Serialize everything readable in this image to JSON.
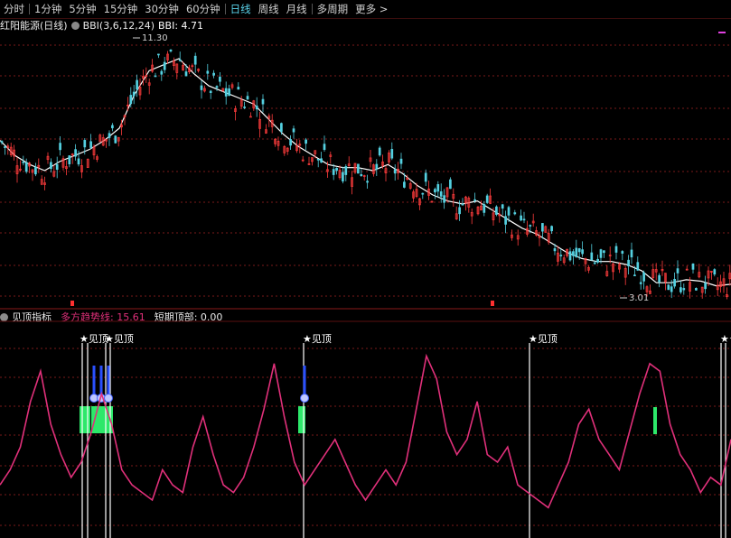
{
  "toolbar": {
    "items": [
      {
        "label": "分时",
        "active": false
      },
      {
        "label": "1分钟",
        "active": false
      },
      {
        "label": "5分钟",
        "active": false
      },
      {
        "label": "15分钟",
        "active": false
      },
      {
        "label": "30分钟",
        "active": false
      },
      {
        "label": "60分钟",
        "active": false
      },
      {
        "label": "日线",
        "active": true
      },
      {
        "label": "周线",
        "active": false
      },
      {
        "label": "月线",
        "active": false
      },
      {
        "label": "多周期",
        "active": false
      },
      {
        "label": "更多 >",
        "active": false
      }
    ]
  },
  "price_panel": {
    "stock_name": "红阳能源(日线)",
    "indicator_params": "BBI(3,6,12,24)",
    "indicator_value": "BBI: 4.71",
    "high_label": "11.30",
    "low_label": "3.01",
    "colors": {
      "up": "#ff3c3c",
      "down": "#54d0e0",
      "bbi": "#ffffff",
      "grid": "#7a1a1a"
    }
  },
  "indicator_panel": {
    "name": "见顶指标",
    "line1_label": "多方趋势线: 15.61",
    "line2_label": "短期顶部: 0.00",
    "signal_text": "★见顶",
    "colors": {
      "trend": "#e0307a",
      "green": "#2de86a",
      "blue": "#2a50ff",
      "grid": "#7a1a1a"
    }
  },
  "chart_data": [
    {
      "type": "line",
      "title": "红阳能源(日线)",
      "series": [
        {
          "name": "BBI",
          "values": [
            8.1,
            7.6,
            7.3,
            7.1,
            7.4,
            7.6,
            7.8,
            8.1,
            8.5,
            9.6,
            10.4,
            10.6,
            10.8,
            10.3,
            9.9,
            9.7,
            9.5,
            9.3,
            8.8,
            8.3,
            7.9,
            7.6,
            7.3,
            7.2,
            7.2,
            7.1,
            7.3,
            7.0,
            6.6,
            6.3,
            6.1,
            6.0,
            6.1,
            5.8,
            5.5,
            5.2,
            5.0,
            4.7,
            4.4,
            4.2,
            4.1,
            4.1,
            4.0,
            3.8,
            3.4,
            3.4,
            3.5,
            3.45,
            3.3,
            3.35
          ]
        }
      ],
      "annotations": [
        "11.30",
        "3.01"
      ]
    },
    {
      "type": "line",
      "title": "见顶指标",
      "series": [
        {
          "name": "多方趋势线",
          "values": [
            14,
            18,
            24,
            36,
            44,
            30,
            22,
            16,
            20,
            28,
            38,
            30,
            18,
            14,
            12,
            10,
            18,
            14,
            12,
            24,
            32,
            22,
            14,
            12,
            16,
            24,
            34,
            46,
            32,
            20,
            14,
            18,
            22,
            26,
            20,
            14,
            10,
            14,
            18,
            14,
            20,
            34,
            48,
            42,
            28,
            22,
            26,
            36,
            22,
            20,
            24,
            14,
            12,
            10,
            8,
            14,
            20,
            30,
            34,
            26,
            22,
            18,
            28,
            38,
            46,
            44,
            30,
            22,
            18,
            12,
            16,
            14,
            26
          ]
        }
      ]
    }
  ]
}
